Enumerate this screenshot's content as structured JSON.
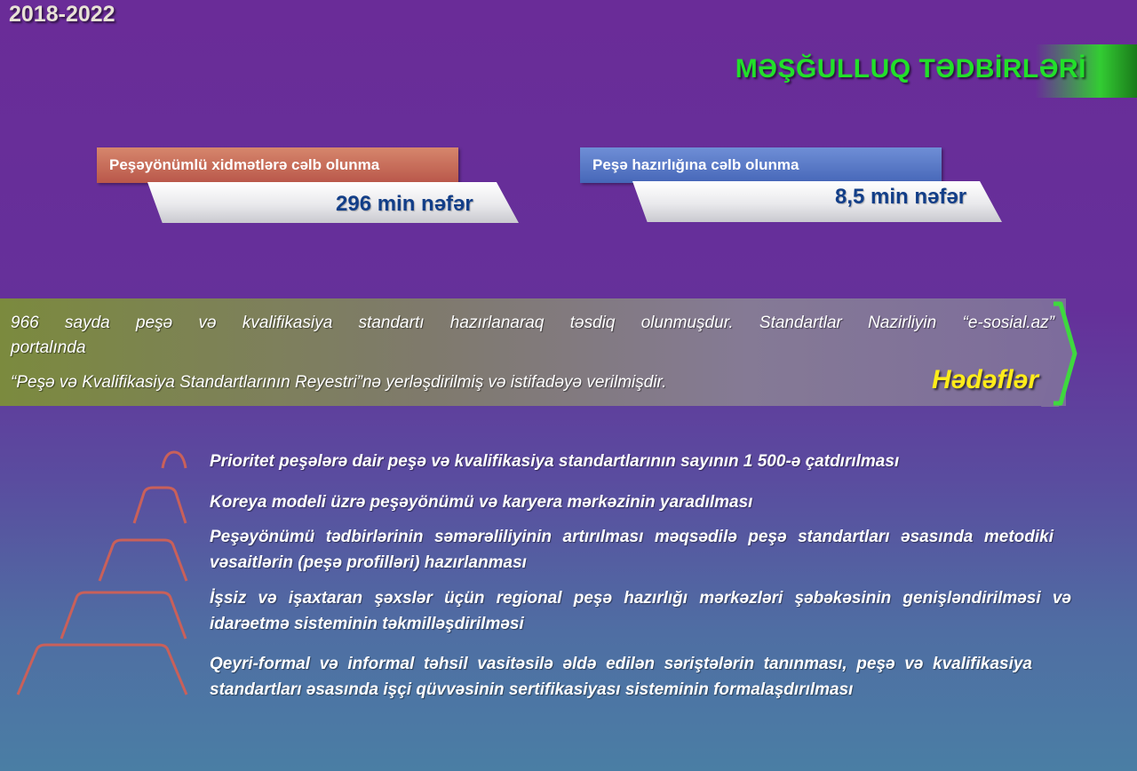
{
  "header": {
    "years": "2018-2022",
    "title": "MƏŞĞULLUQ TƏDBİRLƏRİ"
  },
  "stats": [
    {
      "label": "Peşəyönümlü xidmətlərə cəlb olunma",
      "value": "296 min nəfər"
    },
    {
      "label": "Peşə hazırlığına cəlb olunma",
      "value": "8,5 min nəfər"
    }
  ],
  "achievement": {
    "line1": "966 sayda peşə və kvalifikasiya standartı hazırlanaraq təsdiq olunmuşdur. Standartlar Nazirliyin “e-sosial.az”",
    "line2": "portalında",
    "line3": "“Peşə və Kvalifikasiya Standartlarının Reyestri”nə  yerləşdirilmiş və istifadəyə verilmişdir.",
    "goals_label": "Hədəflər"
  },
  "goals": [
    "Prioritet peşələrə dair peşə və kvalifikasiya standartlarının sayının 1 500-ə çatdırılması",
    "Koreya modeli üzrə peşəyönümü və karyera mərkəzinin yaradılması",
    "Peşəyönümü tədbirlərinin səmərəliliyinin artırılması məqsədilə peşə standartları əsasında metodiki vəsaitlərin (peşə profilləri) hazırlanması",
    "İşsiz və işaxtaran şəxslər üçün regional peşə hazırlığı mərkəzləri şəbəkəsinin genişləndirilməsi və idarəetmə sisteminin təkmilləşdirilməsi",
    "Qeyri-formal və informal təhsil vasitəsilə əldə edilən səriştələrin tanınması, peşə və kvalifikasiya standartları əsasında işçi qüvvəsinin sertifikasiyası sisteminin formalaşdırılması"
  ],
  "colors": {
    "title": "#22e02a",
    "goals_label": "#ffec1a",
    "value_text": "#123e88",
    "arch": "#d9776e"
  }
}
